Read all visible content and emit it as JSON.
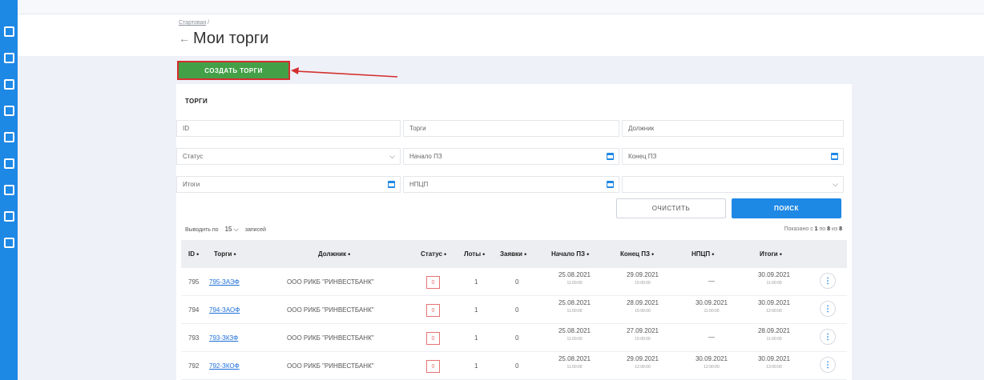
{
  "breadcrumb": {
    "home": "Стартовая",
    "separator": "/"
  },
  "page": {
    "back_icon": "←",
    "title": "Мои торги"
  },
  "create_button": "СОЗДАТЬ ТОРГИ",
  "section_title": "ТОРГИ",
  "filters": {
    "id": "ID",
    "torgi": "Торги",
    "dolzhnik": "Должник",
    "status": "Статус",
    "nachalo": "Начало ПЗ",
    "konec": "Конец ПЗ",
    "itogi": "Итоги",
    "npcp": "НПЦП",
    "empty_select": ""
  },
  "buttons": {
    "clear": "ОЧИСТИТЬ",
    "search": "ПОИСК"
  },
  "paging": {
    "prefix": "Выводить по",
    "value": "15",
    "suffix": "записей",
    "shown_prefix": "Показано с",
    "shown_from": "1",
    "shown_mid": "по",
    "shown_to": "8",
    "shown_of": "из",
    "shown_total": "8"
  },
  "columns": [
    "ID ⬩",
    "Торги ⬩",
    "Должник ⬩",
    "Статус ⬩",
    "Лоты ⬩",
    "Заявки ⬩",
    "Начало ПЗ ⬩",
    "Конец ПЗ ⬩",
    "НПЦП ⬩",
    "Итоги ⬩"
  ],
  "rows": [
    {
      "id": "795",
      "code": "795-ЗАЭФ",
      "debtor": "ООО РИКБ \"РИНВЕСТБАНК\"",
      "status": "0",
      "lots": "1",
      "bids": "0",
      "start_d": "25.08.2021",
      "start_t": "11:00:00",
      "end_d": "29.09.2021",
      "end_t": "15:00:00",
      "npcp_d": "—",
      "npcp_t": "",
      "res_d": "30.09.2021",
      "res_t": "11:00:00"
    },
    {
      "id": "794",
      "code": "794-ЗАОФ",
      "debtor": "ООО РИКБ \"РИНВЕСТБАНК\"",
      "status": "0",
      "lots": "1",
      "bids": "0",
      "start_d": "25.08.2021",
      "start_t": "11:00:00",
      "end_d": "28.09.2021",
      "end_t": "15:00:00",
      "npcp_d": "30.09.2021",
      "npcp_t": "11:00:00",
      "res_d": "30.09.2021",
      "res_t": "12:00:00"
    },
    {
      "id": "793",
      "code": "793-ЗКЗФ",
      "debtor": "ООО РИКБ \"РИНВЕСТБАНК\"",
      "status": "0",
      "lots": "1",
      "bids": "0",
      "start_d": "25.08.2021",
      "start_t": "11:00:00",
      "end_d": "27.09.2021",
      "end_t": "15:00:00",
      "npcp_d": "—",
      "npcp_t": "",
      "res_d": "28.09.2021",
      "res_t": "11:00:00"
    },
    {
      "id": "792",
      "code": "792-ЗКОФ",
      "debtor": "ООО РИКБ \"РИНВЕСТБАНК\"",
      "status": "0",
      "lots": "1",
      "bids": "0",
      "start_d": "25.08.2021",
      "start_t": "11:00:00",
      "end_d": "29.09.2021",
      "end_t": "12:00:00",
      "npcp_d": "30.09.2021",
      "npcp_t": "12:00:00",
      "res_d": "30.09.2021",
      "res_t": "13:00:00"
    }
  ],
  "colors": {
    "sidebar": "#1e88e5",
    "create": "#43a047",
    "highlight": "#d32f2f",
    "link": "#1e6fd9"
  }
}
